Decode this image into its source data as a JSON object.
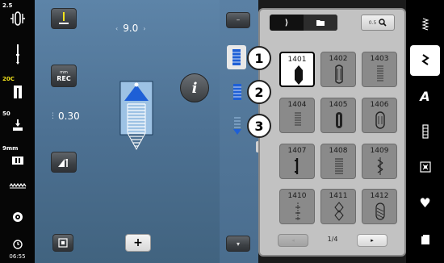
{
  "status": {
    "tension": "2.5",
    "presser_foot": "20C",
    "foot_height": "50",
    "stitch_width": "9mm",
    "time": "06:55"
  },
  "main": {
    "stitch_width_value": "9.0",
    "stitch_length_value": "0.30",
    "reverse_label": "REC",
    "reverse_unit": "mm"
  },
  "grid": {
    "cells": [
      "1401",
      "1402",
      "1403",
      "1404",
      "1405",
      "1406",
      "1407",
      "1408",
      "1409",
      "1410",
      "1411",
      "1412"
    ],
    "selected": "1401",
    "page_indicator": "1/4",
    "zoom_label": "0.5"
  },
  "callouts": [
    "1",
    "2",
    "3"
  ],
  "colors": {
    "accent_blue": "#1e5fd6",
    "panel_bg": "#c2c2c2"
  },
  "icons": {
    "info": "info-icon",
    "favorites": "heart-icon",
    "alphabet": "alphabet-icon"
  }
}
